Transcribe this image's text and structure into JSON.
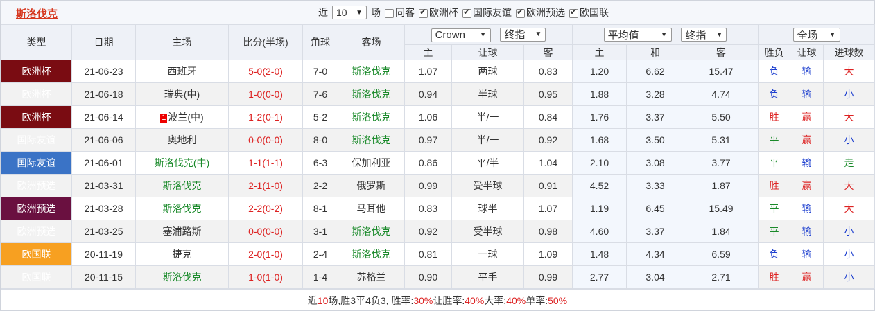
{
  "header": {
    "team": "斯洛伐克",
    "recent_label": "近",
    "count_value": "10",
    "count_unit": "场",
    "filters": [
      {
        "label": "同客",
        "checked": false
      },
      {
        "label": "欧洲杯",
        "checked": true
      },
      {
        "label": "国际友谊",
        "checked": true
      },
      {
        "label": "欧洲预选",
        "checked": true
      },
      {
        "label": "欧国联",
        "checked": true
      }
    ]
  },
  "columns": {
    "type": "类型",
    "date": "日期",
    "home": "主场",
    "score": "比分(半场)",
    "corner": "角球",
    "away": "客场",
    "company": "Crown",
    "odds_kind": "终指",
    "avg": "平均值",
    "avg_kind": "终指",
    "scope": "全场",
    "sub": {
      "ah_home": "主",
      "ah_line": "让球",
      "ah_away": "客",
      "eu_home": "主",
      "eu_draw": "和",
      "eu_away": "客",
      "result": "胜负",
      "handicap": "让球",
      "goals": "进球数"
    }
  },
  "rows": [
    {
      "type": "欧洲杯",
      "tclass": "euro",
      "date": "21-06-23",
      "home": "西班牙",
      "home_green": false,
      "badge": "",
      "score": "5-0",
      "half": "(2-0)",
      "corner": "7-0",
      "away": "斯洛伐克",
      "away_green": true,
      "h": "1.07",
      "line": "两球",
      "a": "0.83",
      "e1": "1.20",
      "e2": "6.62",
      "e3": "15.47",
      "res": "负",
      "hc": "输",
      "goals": "大"
    },
    {
      "type": "欧洲杯",
      "tclass": "euro",
      "date": "21-06-18",
      "home": "瑞典(中)",
      "home_green": false,
      "badge": "",
      "score": "1-0",
      "half": "(0-0)",
      "corner": "7-6",
      "away": "斯洛伐克",
      "away_green": true,
      "h": "0.94",
      "line": "半球",
      "a": "0.95",
      "e1": "1.88",
      "e2": "3.28",
      "e3": "4.74",
      "res": "负",
      "hc": "输",
      "goals": "小"
    },
    {
      "type": "欧洲杯",
      "tclass": "euro",
      "date": "21-06-14",
      "home": "波兰(中)",
      "home_green": false,
      "badge": "1",
      "score": "1-2",
      "half": "(0-1)",
      "corner": "5-2",
      "away": "斯洛伐克",
      "away_green": true,
      "h": "1.06",
      "line": "半/一",
      "a": "0.84",
      "e1": "1.76",
      "e2": "3.37",
      "e3": "5.50",
      "res": "胜",
      "hc": "赢",
      "goals": "大"
    },
    {
      "type": "国际友谊",
      "tclass": "friend",
      "date": "21-06-06",
      "home": "奥地利",
      "home_green": false,
      "badge": "",
      "score": "0-0",
      "half": "(0-0)",
      "corner": "8-0",
      "away": "斯洛伐克",
      "away_green": true,
      "h": "0.97",
      "line": "半/一",
      "a": "0.92",
      "e1": "1.68",
      "e2": "3.50",
      "e3": "5.31",
      "res": "平",
      "hc": "赢",
      "goals": "小"
    },
    {
      "type": "国际友谊",
      "tclass": "friend",
      "date": "21-06-01",
      "home": "斯洛伐克(中)",
      "home_green": true,
      "badge": "",
      "score": "1-1",
      "half": "(1-1)",
      "corner": "6-3",
      "away": "保加利亚",
      "away_green": false,
      "h": "0.86",
      "line": "平/半",
      "a": "1.04",
      "e1": "2.10",
      "e2": "3.08",
      "e3": "3.77",
      "res": "平",
      "hc": "输",
      "goals": "走"
    },
    {
      "type": "欧洲预选",
      "tclass": "qual",
      "date": "21-03-31",
      "home": "斯洛伐克",
      "home_green": true,
      "badge": "",
      "score": "2-1",
      "half": "(1-0)",
      "corner": "2-2",
      "away": "俄罗斯",
      "away_green": false,
      "h": "0.99",
      "line": "受半球",
      "a": "0.91",
      "e1": "4.52",
      "e2": "3.33",
      "e3": "1.87",
      "res": "胜",
      "hc": "赢",
      "goals": "大"
    },
    {
      "type": "欧洲预选",
      "tclass": "qual",
      "date": "21-03-28",
      "home": "斯洛伐克",
      "home_green": true,
      "badge": "",
      "score": "2-2",
      "half": "(0-2)",
      "corner": "8-1",
      "away": "马耳他",
      "away_green": false,
      "h": "0.83",
      "line": "球半",
      "a": "1.07",
      "e1": "1.19",
      "e2": "6.45",
      "e3": "15.49",
      "res": "平",
      "hc": "输",
      "goals": "大"
    },
    {
      "type": "欧洲预选",
      "tclass": "qual",
      "date": "21-03-25",
      "home": "塞浦路斯",
      "home_green": false,
      "badge": "",
      "score": "0-0",
      "half": "(0-0)",
      "corner": "3-1",
      "away": "斯洛伐克",
      "away_green": true,
      "h": "0.92",
      "line": "受半球",
      "a": "0.98",
      "e1": "4.60",
      "e2": "3.37",
      "e3": "1.84",
      "res": "平",
      "hc": "输",
      "goals": "小"
    },
    {
      "type": "欧国联",
      "tclass": "nl",
      "date": "20-11-19",
      "home": "捷克",
      "home_green": false,
      "badge": "",
      "score": "2-0",
      "half": "(1-0)",
      "corner": "2-4",
      "away": "斯洛伐克",
      "away_green": true,
      "h": "0.81",
      "line": "一球",
      "a": "1.09",
      "e1": "1.48",
      "e2": "4.34",
      "e3": "6.59",
      "res": "负",
      "hc": "输",
      "goals": "小"
    },
    {
      "type": "欧国联",
      "tclass": "nl",
      "date": "20-11-15",
      "home": "斯洛伐克",
      "home_green": true,
      "badge": "",
      "score": "1-0",
      "half": "(1-0)",
      "corner": "1-4",
      "away": "苏格兰",
      "away_green": false,
      "h": "0.90",
      "line": "平手",
      "a": "0.99",
      "e1": "2.77",
      "e2": "3.04",
      "e3": "2.71",
      "res": "胜",
      "hc": "赢",
      "goals": "小"
    }
  ],
  "footer": {
    "p1": "近",
    "n_games": "10",
    "p2": "场,胜3平4负3, 胜率:",
    "win_rate": "30%",
    "p3": " 让胜率:",
    "hc_rate": "40%",
    "p4": " 大率:",
    "big_rate": "40%",
    "p5": " 单率:",
    "odd_rate": "50%"
  },
  "colors": {
    "red": "#dd2222",
    "green": "#1a8a2a",
    "blue": "#1d3fcf",
    "euro": "#7a0c12",
    "friend": "#3a73c6",
    "qual": "#6a1040",
    "nl": "#f7a021"
  }
}
